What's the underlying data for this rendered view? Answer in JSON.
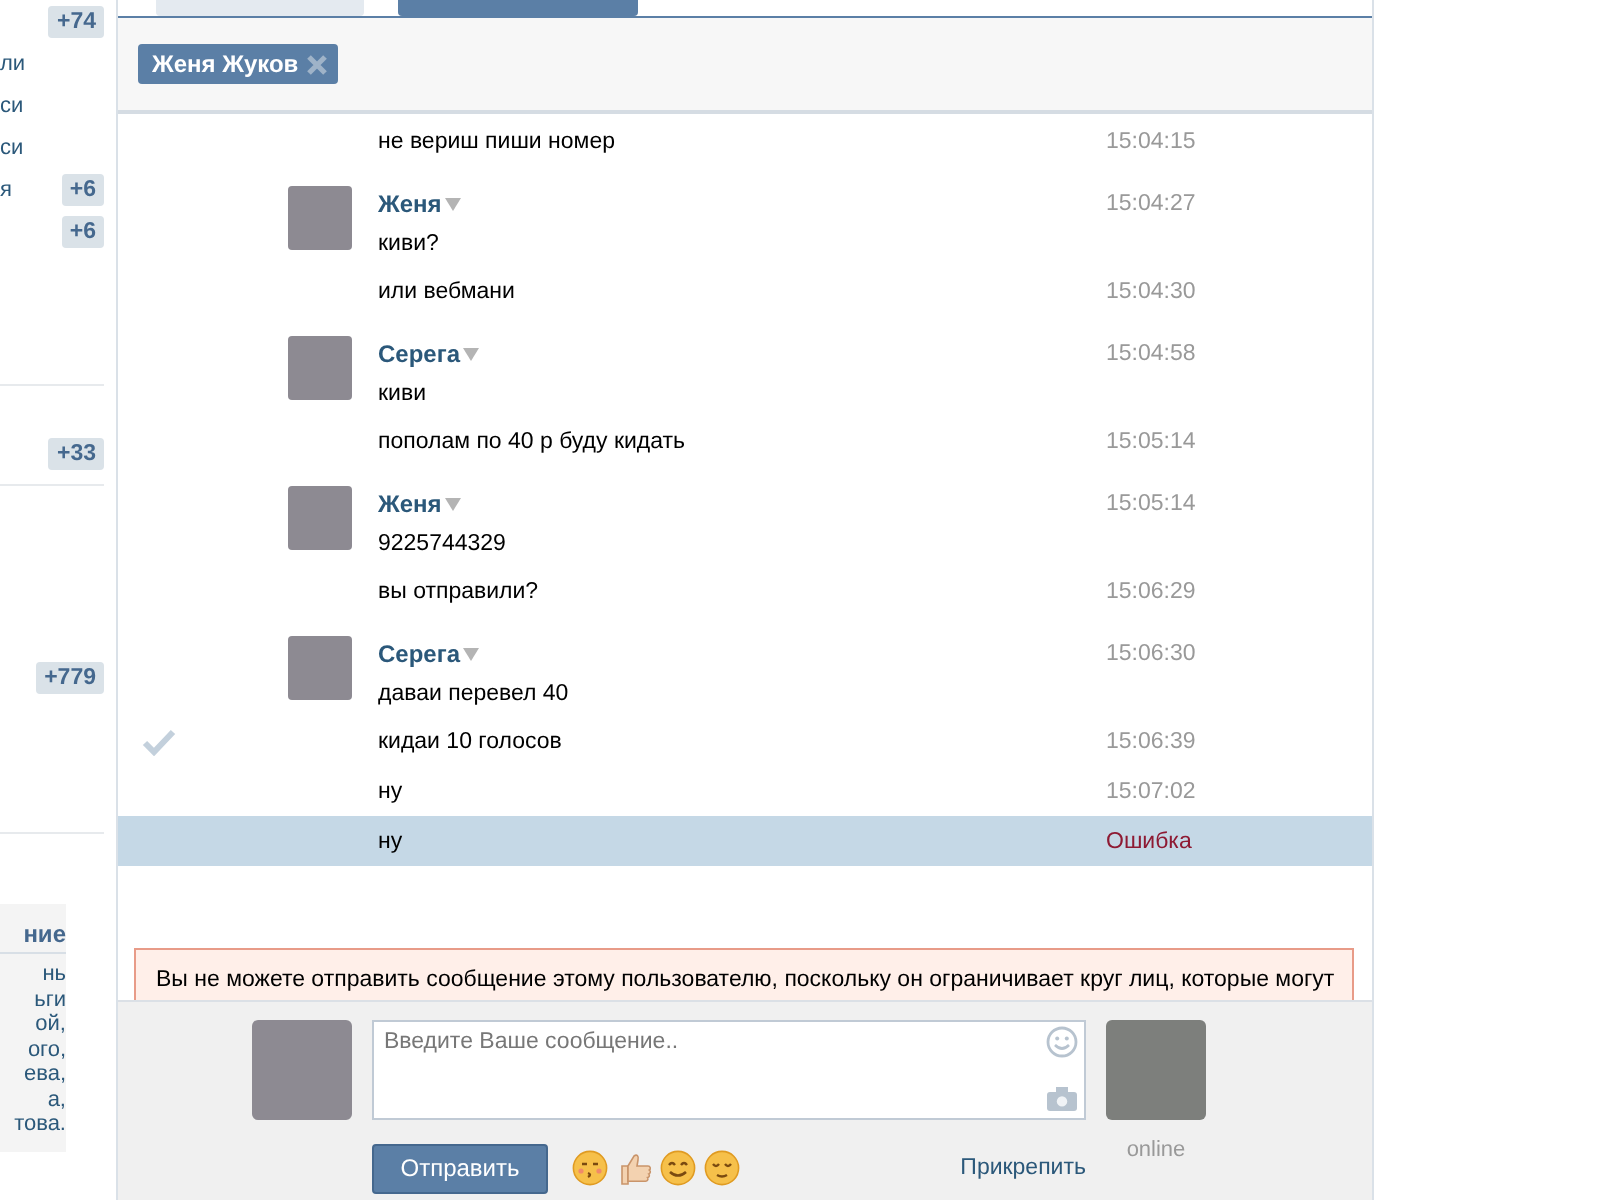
{
  "sidebar": {
    "groups": [
      {
        "rows": [
          {
            "counter": "+74"
          },
          {
            "label": "ли"
          },
          {
            "label": "си"
          },
          {
            "label": "си"
          },
          {
            "label": "я",
            "counter": "+6"
          },
          {
            "counter": "+6"
          }
        ]
      },
      {
        "rows": [
          {
            "counter": "+33"
          }
        ]
      },
      {
        "rows": [
          {
            "counter": "+779"
          }
        ]
      }
    ],
    "box": {
      "title": "ние",
      "lines": [
        "нь",
        "ьги",
        "ой,",
        "ого,",
        "ева,",
        "а,",
        "това."
      ]
    }
  },
  "tabs": [
    {
      "selected": false
    },
    {
      "selected": true
    }
  ],
  "recipient_chip": {
    "name": "Женя Жуков"
  },
  "messages": [
    {
      "text": "не вериш пиши номер",
      "time": "15:04:15",
      "failed": false,
      "checked": false,
      "selected": false
    },
    {
      "author": "Женя",
      "text": "киви?",
      "time": "15:04:27",
      "failed": false,
      "checked": false,
      "selected": false
    },
    {
      "text": "или вебмани",
      "time": "15:04:30",
      "failed": false,
      "checked": false,
      "selected": false
    },
    {
      "author": "Серега",
      "text": "киви",
      "time": "15:04:58",
      "failed": false,
      "checked": false,
      "selected": false
    },
    {
      "text": "пополам по 40 р буду кидать",
      "time": "15:05:14",
      "failed": false,
      "checked": false,
      "selected": false
    },
    {
      "author": "Женя",
      "text": "9225744329",
      "time": "15:05:14",
      "failed": false,
      "checked": false,
      "selected": false
    },
    {
      "text": "вы отправили?",
      "time": "15:06:29",
      "failed": false,
      "checked": false,
      "selected": false
    },
    {
      "author": "Серега",
      "text": "даваи перевел 40",
      "time": "15:06:30",
      "failed": false,
      "checked": false,
      "selected": false
    },
    {
      "text": "кидаи 10 голосов",
      "time": "15:06:39",
      "failed": false,
      "checked": true,
      "selected": false
    },
    {
      "text": "ну",
      "time": "15:07:02",
      "failed": false,
      "checked": false,
      "selected": false
    },
    {
      "text": "ну",
      "time": "Ошибка",
      "failed": true,
      "checked": false,
      "selected": true
    }
  ],
  "warning": {
    "text": "Вы не можете отправить сообщение этому пользователю, поскольку он ограничивает круг лиц, которые могут"
  },
  "composer": {
    "placeholder": "Введите Ваше сообщение..",
    "send_button": "Отправить",
    "attach_link": "Прикрепить",
    "partner_status": "online"
  }
}
